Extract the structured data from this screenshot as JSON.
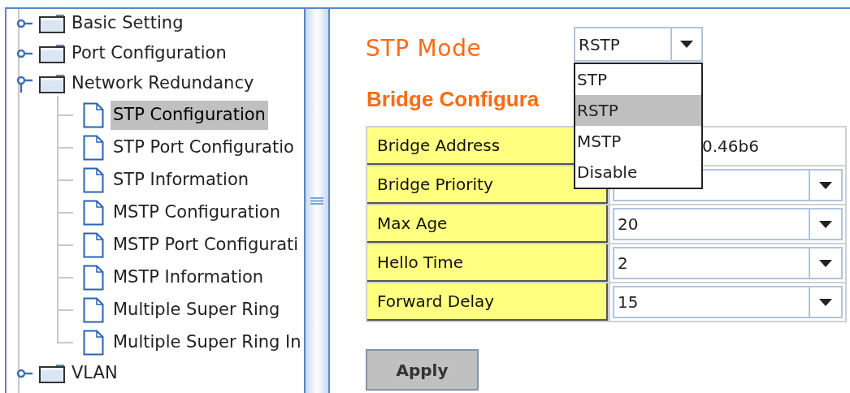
{
  "tree": [
    {
      "label": "Basic Setting",
      "expanded": false,
      "selected": false
    },
    {
      "label": "Port Configuration",
      "expanded": false,
      "selected": false
    },
    {
      "label": "Network Redundancy",
      "expanded": true,
      "selected": false,
      "children": [
        {
          "label": "STP Configuration",
          "selected": true
        },
        {
          "label": "STP Port Configuratio",
          "selected": false
        },
        {
          "label": "STP Information",
          "selected": false
        },
        {
          "label": "MSTP Configuration",
          "selected": false
        },
        {
          "label": "MSTP Port Configurati",
          "selected": false
        },
        {
          "label": "MSTP Information",
          "selected": false
        },
        {
          "label": "Multiple Super Ring",
          "selected": false
        },
        {
          "label": "Multiple Super Ring In",
          "selected": false
        }
      ]
    },
    {
      "label": "VLAN",
      "expanded": false,
      "selected": false
    }
  ],
  "stp_mode": {
    "label": "STP Mode",
    "value": "RSTP",
    "options": [
      {
        "label": "STP",
        "selected": false
      },
      {
        "label": "RSTP",
        "selected": true
      },
      {
        "label": "MSTP",
        "selected": false
      },
      {
        "label": "Disable",
        "selected": false
      }
    ]
  },
  "bridge_configuration": {
    "title": "Bridge Configura",
    "rows": [
      {
        "label": "Bridge Address",
        "kind": "text",
        "value": "0.46b6"
      },
      {
        "label": "Bridge Priority",
        "kind": "select",
        "value": ""
      },
      {
        "label": "Max Age",
        "kind": "select",
        "value": "20"
      },
      {
        "label": "Hello Time",
        "kind": "select",
        "value": "2"
      },
      {
        "label": "Forward Delay",
        "kind": "select",
        "value": "15"
      }
    ]
  },
  "apply_button": "Apply"
}
